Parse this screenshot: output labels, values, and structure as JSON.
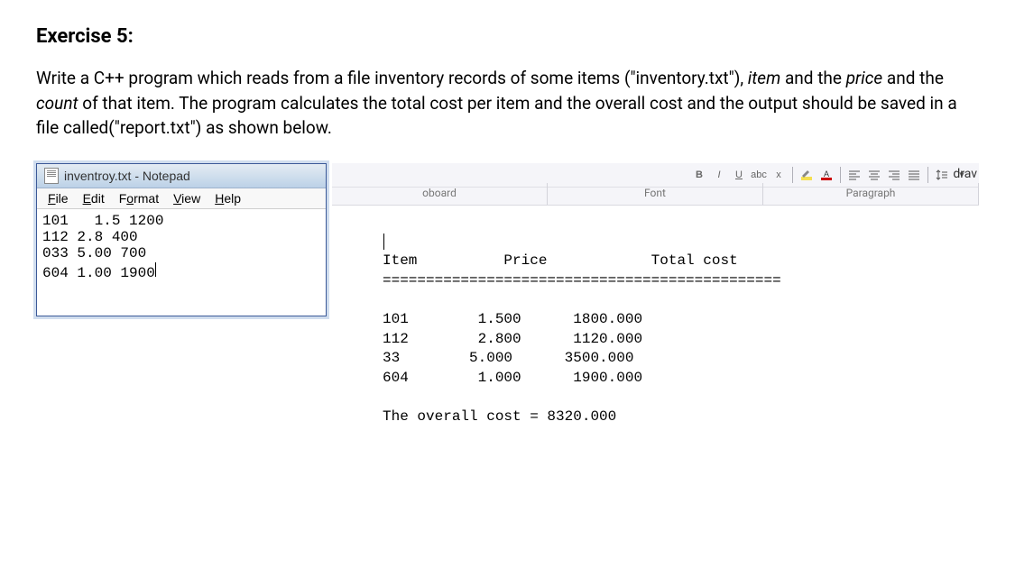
{
  "title": "Exercise 5:",
  "description_parts": {
    "p1": "Write a C++ program which reads from a file inventory records of some items (\"inventory.txt\"), ",
    "p2_italic1": "item",
    "p3": " and the ",
    "p4_italic2": "price",
    "p5": "  and the ",
    "p6_italic3": "count",
    "p7": " of that item. The program calculates the total cost per item and the overall cost and the output should be saved in a file called(\"report.txt\") as shown below."
  },
  "notepad": {
    "title": "inventroy.txt - Notepad",
    "menu": {
      "file": "File",
      "edit": "Edit",
      "format": "Format",
      "view": "View",
      "help": "Help"
    },
    "content": "101   1.5 1200\n112 2.8 400\n033 5.00 700\n604 1.00 1900"
  },
  "ribbon": {
    "group1": "oboard",
    "group2": "Font",
    "group3": "Paragraph",
    "draw": "drav"
  },
  "report": {
    "header": "Item          Price            Total cost",
    "divider": "==============================================",
    "rows": [
      "101        1.500      1800.000",
      "112        2.800      1120.000",
      "33        5.000      3500.000",
      "604        1.000      1900.000"
    ],
    "overall": "The overall cost = 8320.000"
  },
  "chart_data": {
    "type": "table",
    "title": "report.txt",
    "columns": [
      "Item",
      "Price",
      "Total cost"
    ],
    "rows": [
      {
        "Item": 101,
        "Price": 1.5,
        "Total cost": 1800.0
      },
      {
        "Item": 112,
        "Price": 2.8,
        "Total cost": 1120.0
      },
      {
        "Item": 33,
        "Price": 5.0,
        "Total cost": 3500.0
      },
      {
        "Item": 604,
        "Price": 1.0,
        "Total cost": 1900.0
      }
    ],
    "summary": {
      "overall_cost": 8320.0
    }
  }
}
